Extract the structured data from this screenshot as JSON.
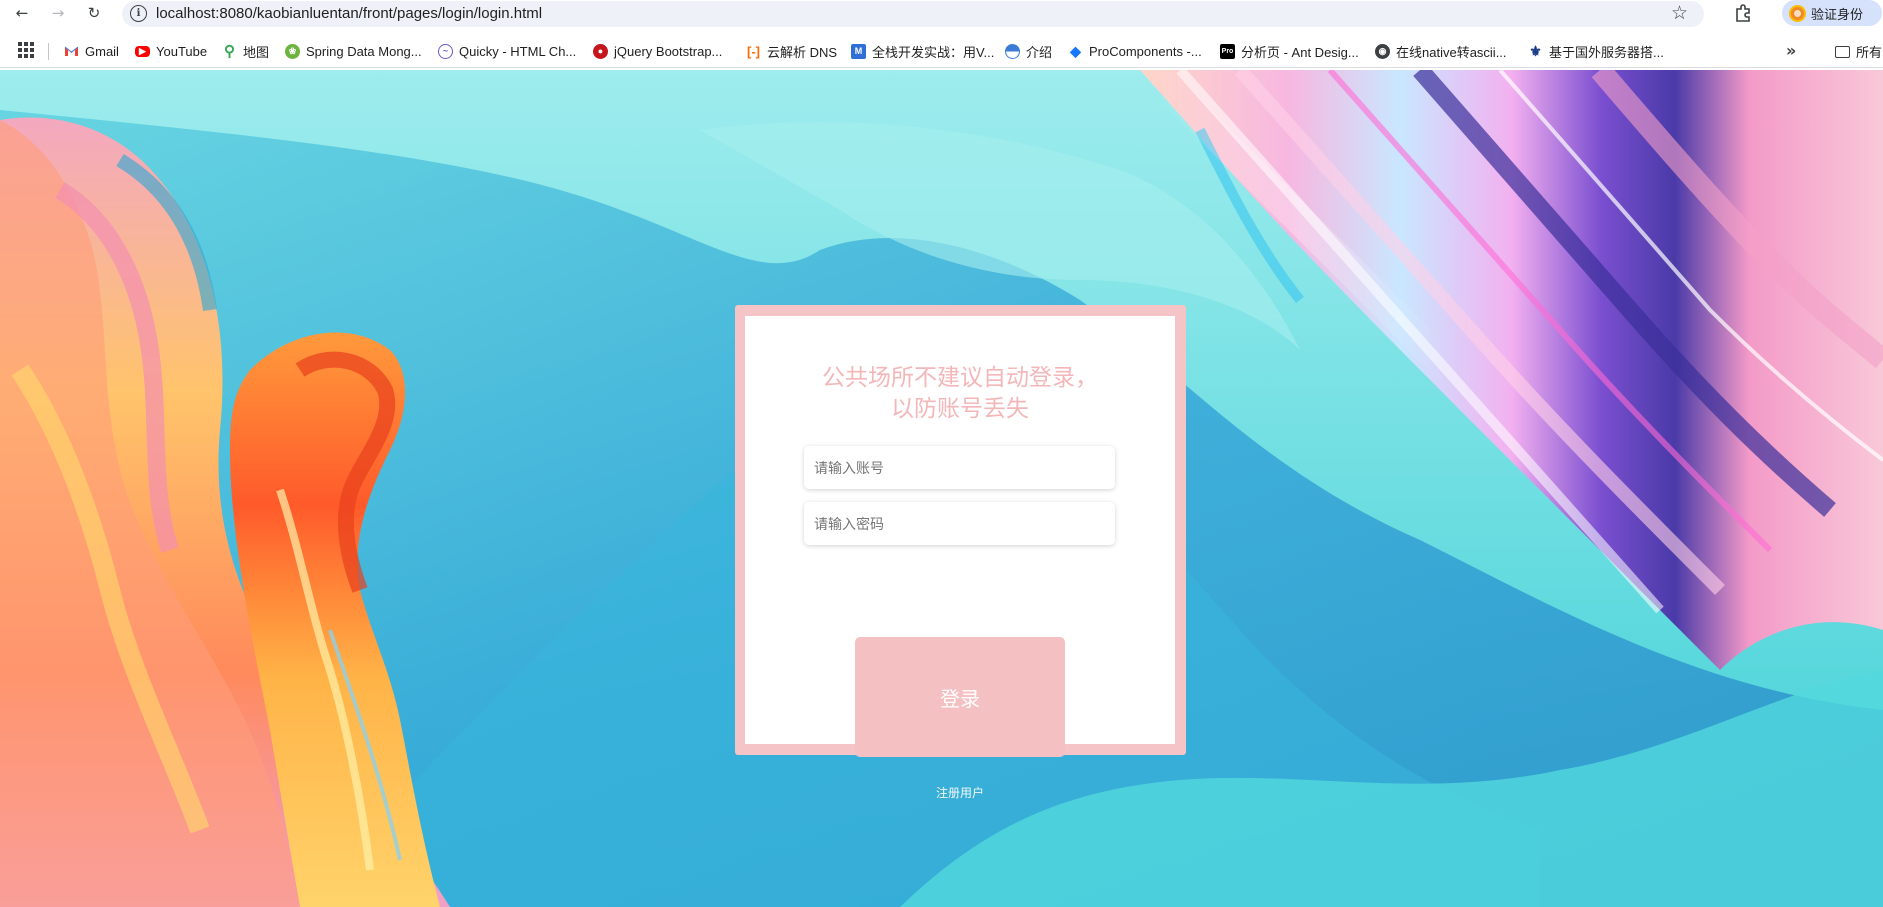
{
  "browser": {
    "url": "localhost:8080/kaobianluentan/front/pages/login/login.html",
    "profile_label": "验证身份",
    "bookmarks": [
      {
        "label": "Gmail",
        "icon": "gmail-icon"
      },
      {
        "label": "YouTube",
        "icon": "youtube-icon"
      },
      {
        "label": "地图",
        "icon": "maps-pin-icon"
      },
      {
        "label": "Spring Data Mong...",
        "icon": "spring-leaf-icon"
      },
      {
        "label": "Quicky - HTML Ch...",
        "icon": "messenger-icon"
      },
      {
        "label": "jQuery Bootstrap...",
        "icon": "red-circle-icon"
      },
      {
        "label": "云解析 DNS",
        "icon": "aliyun-icon"
      },
      {
        "label": "全栈开发实战：用V...",
        "icon": "m-square-icon"
      },
      {
        "label": "介绍",
        "icon": "globe-wave-icon"
      },
      {
        "label": "ProComponents -...",
        "icon": "diamond-icon"
      },
      {
        "label": "分析页 - Ant Desig...",
        "icon": "pro-logo-icon"
      },
      {
        "label": "在线native转ascii...",
        "icon": "globe-icon"
      },
      {
        "label": "基于国外服务器搭...",
        "icon": "hat-icon"
      }
    ],
    "all_bookmarks_label": "所有"
  },
  "login": {
    "notice_line1": "公共场所不建议自动登录，",
    "notice_line2": "以防账号丢失",
    "account_placeholder": "请输入账号",
    "password_placeholder": "请输入密码",
    "login_label": "登录",
    "register_label": "注册用户"
  },
  "colors": {
    "card_border": "#f5c4c6",
    "notice_text": "#f3b7b9",
    "login_button": "#f5c0c2",
    "background_cyan": "#4fd6dc"
  }
}
